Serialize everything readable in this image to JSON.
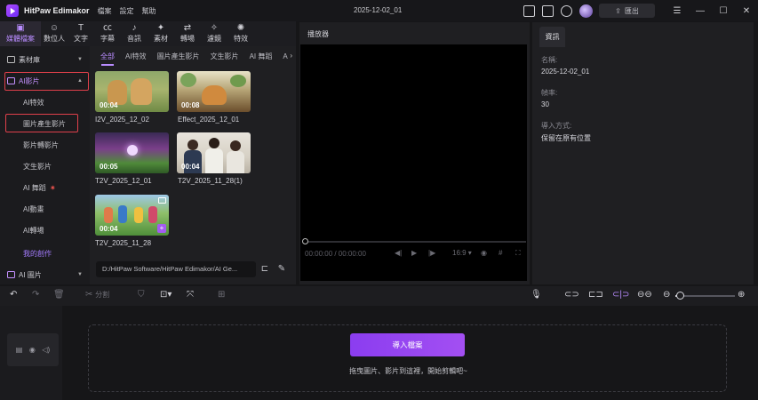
{
  "titlebar": {
    "app_title": "HitPaw Edimakor",
    "menu": [
      "檔案",
      "設定",
      "幫助"
    ],
    "doc_title": "2025-12-02_01",
    "export_label": "匯出"
  },
  "toolbar": {
    "tools": [
      {
        "label": "媒體檔案",
        "icon": "media-icon",
        "glyph": "▣"
      },
      {
        "label": "數位人",
        "icon": "avatar-icon",
        "glyph": "☺"
      },
      {
        "label": "文字",
        "icon": "text-icon",
        "glyph": "T"
      },
      {
        "label": "字幕",
        "icon": "subtitle-icon",
        "glyph": "㏄"
      },
      {
        "label": "音訊",
        "icon": "audio-icon",
        "glyph": "♪"
      },
      {
        "label": "素材",
        "icon": "sticker-icon",
        "glyph": "✦"
      },
      {
        "label": "轉場",
        "icon": "transition-icon",
        "glyph": "⇄"
      },
      {
        "label": "濾鏡",
        "icon": "filter-icon",
        "glyph": "✧"
      },
      {
        "label": "特效",
        "icon": "effect-icon",
        "glyph": "✺"
      }
    ]
  },
  "sidebar": {
    "library": "素材庫",
    "ai_video": "AI影片",
    "subitems": [
      "AI特效",
      "圖片產生影片",
      "影片轉影片",
      "文生影片",
      "AI 舞蹈",
      "AI動畫",
      "AI轉場"
    ],
    "my_creations": "我的創作",
    "ai_image": "AI 圖片"
  },
  "media": {
    "tabs": [
      "全部",
      "AI特效",
      "圖片產生影片",
      "文生影片",
      "AI 舞蹈",
      "AI"
    ],
    "items": [
      {
        "name": "I2V_2025_12_02",
        "duration": "00:04"
      },
      {
        "name": "Effect_2025_12_01",
        "duration": "00:08"
      },
      {
        "name": "T2V_2025_12_01",
        "duration": "00:05"
      },
      {
        "name": "T2V_2025_11_28(1)",
        "duration": "00:04"
      },
      {
        "name": "T2V_2025_11_28",
        "duration": "00:04"
      }
    ],
    "path": "D:/HitPaw Software/HitPaw Edimakor/AI Ge..."
  },
  "player": {
    "title": "播放器",
    "time": "00:00:00 / 00:00:00",
    "ratio": "16:9"
  },
  "info": {
    "tab": "資訊",
    "name_label": "名稱:",
    "name_value": "2025-12-02_01",
    "fps_label": "幀率:",
    "fps_value": "30",
    "import_label": "導入方式:",
    "import_value": "保留在原有位置"
  },
  "timeline": {
    "split_label": "分割",
    "import_button": "導入檔案",
    "drop_hint": "拖曳圖片、影片到這裡，開始剪輯吧~"
  },
  "colors": {
    "accent": "#b98cff",
    "highlight_box": "#e0404b",
    "import_button": "#9546f1"
  }
}
